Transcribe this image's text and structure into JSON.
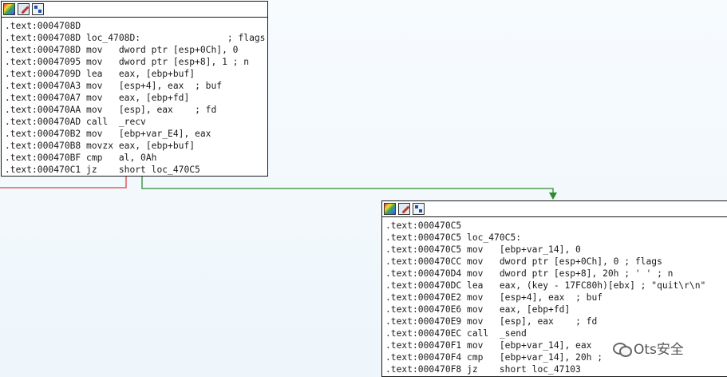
{
  "block1": {
    "lines": [
      {
        "addr": ".text:0004708D",
        "mnemonic": "",
        "operands": "",
        "comment": ""
      },
      {
        "addr": ".text:0004708D",
        "mnemonic": "loc_4708D:",
        "operands": "",
        "comment": "; flags"
      },
      {
        "addr": ".text:0004708D",
        "mnemonic": "mov",
        "operands": "dword ptr [esp+0Ch], 0",
        "comment": ""
      },
      {
        "addr": ".text:00047095",
        "mnemonic": "mov",
        "operands": "dword ptr [esp+8], 1 ; n",
        "comment": ""
      },
      {
        "addr": ".text:0004709D",
        "mnemonic": "lea",
        "operands": "eax, [ebp+buf]",
        "comment": ""
      },
      {
        "addr": ".text:000470A3",
        "mnemonic": "mov",
        "operands": "[esp+4], eax",
        "comment": "; buf"
      },
      {
        "addr": ".text:000470A7",
        "mnemonic": "mov",
        "operands": "eax, [ebp+fd]",
        "comment": ""
      },
      {
        "addr": ".text:000470AA",
        "mnemonic": "mov",
        "operands": "[esp], eax",
        "comment": "; fd"
      },
      {
        "addr": ".text:000470AD",
        "mnemonic": "call",
        "operands": "_recv",
        "comment": ""
      },
      {
        "addr": ".text:000470B2",
        "mnemonic": "mov",
        "operands": "[ebp+var_E4], eax",
        "comment": ""
      },
      {
        "addr": ".text:000470B8",
        "mnemonic": "movzx",
        "operands": "eax, [ebp+buf]",
        "comment": ""
      },
      {
        "addr": ".text:000470BF",
        "mnemonic": "cmp",
        "operands": "al, 0Ah",
        "comment": ""
      },
      {
        "addr": ".text:000470C1",
        "mnemonic": "jz",
        "operands": "short loc_470C5",
        "comment": ""
      }
    ]
  },
  "block2": {
    "lines": [
      {
        "addr": ".text:000470C5",
        "mnemonic": "",
        "operands": "",
        "comment": ""
      },
      {
        "addr": ".text:000470C5",
        "mnemonic": "loc_470C5:",
        "operands": "",
        "comment": ""
      },
      {
        "addr": ".text:000470C5",
        "mnemonic": "mov",
        "operands": "[ebp+var_14], 0",
        "comment": ""
      },
      {
        "addr": ".text:000470CC",
        "mnemonic": "mov",
        "operands": "dword ptr [esp+0Ch], 0 ; flags",
        "comment": ""
      },
      {
        "addr": ".text:000470D4",
        "mnemonic": "mov",
        "operands": "dword ptr [esp+8], 20h ; ' ' ; n",
        "comment": ""
      },
      {
        "addr": ".text:000470DC",
        "mnemonic": "lea",
        "operands": "eax, (key - 17FC80h)[ebx] ; \"quit\\r\\n\"",
        "comment": ""
      },
      {
        "addr": ".text:000470E2",
        "mnemonic": "mov",
        "operands": "[esp+4], eax",
        "comment": "; buf"
      },
      {
        "addr": ".text:000470E6",
        "mnemonic": "mov",
        "operands": "eax, [ebp+fd]",
        "comment": ""
      },
      {
        "addr": ".text:000470E9",
        "mnemonic": "mov",
        "operands": "[esp], eax",
        "comment": "; fd"
      },
      {
        "addr": ".text:000470EC",
        "mnemonic": "call",
        "operands": "_send",
        "comment": ""
      },
      {
        "addr": ".text:000470F1",
        "mnemonic": "mov",
        "operands": "[ebp+var_14], eax",
        "comment": ""
      },
      {
        "addr": ".text:000470F4",
        "mnemonic": "cmp",
        "operands": "[ebp+var_14], 20h ;",
        "comment": ""
      },
      {
        "addr": ".text:000470F8",
        "mnemonic": "jz",
        "operands": "short loc_47103",
        "comment": ""
      }
    ]
  },
  "icons": [
    "color-icon",
    "edit-icon",
    "graph-icon"
  ],
  "edges": {
    "true_color": "#2e8b2e",
    "false_color": "#e04040"
  },
  "watermark": {
    "text": "Ots安全"
  }
}
